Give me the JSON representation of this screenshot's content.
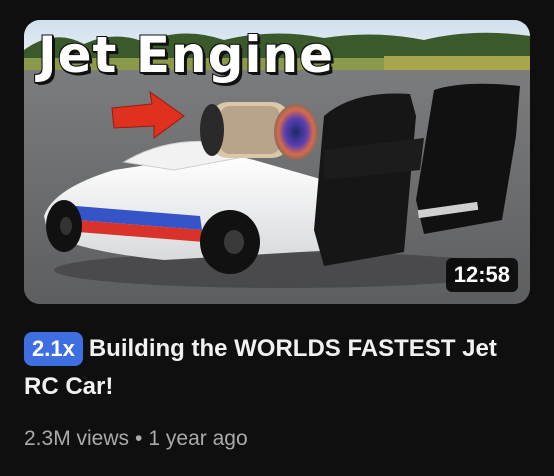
{
  "video": {
    "thumbnail_text": "Jet Engine",
    "duration": "12:58",
    "playback_speed": "2.1x",
    "title": "Building the WORLDS FASTEST Jet RC Car!",
    "views": "2.3M views",
    "separator": "•",
    "age": "1 year ago"
  },
  "colors": {
    "background": "#0f0f0f",
    "speed_badge": "#3d6fe0",
    "title_text": "#f1f1f1",
    "meta_text": "#aaaaaa",
    "arrow": "#e0301e"
  }
}
